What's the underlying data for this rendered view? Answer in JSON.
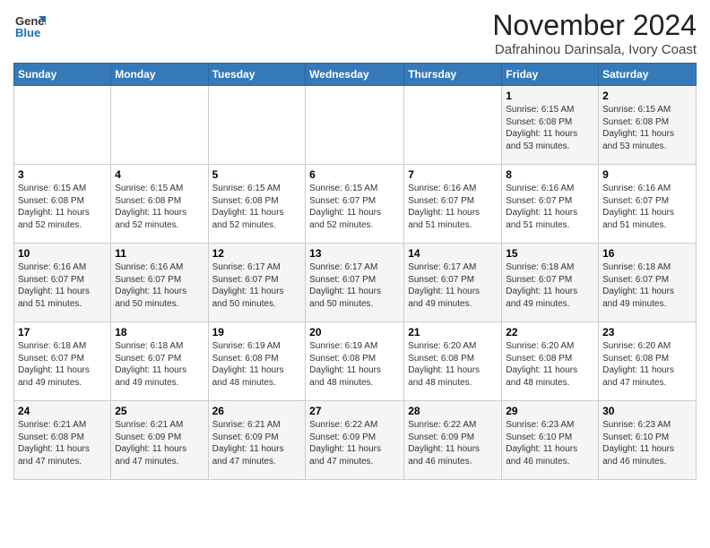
{
  "header": {
    "logo_line1": "General",
    "logo_line2": "Blue",
    "month_year": "November 2024",
    "location": "Dafrahinou Darinsala, Ivory Coast"
  },
  "weekdays": [
    "Sunday",
    "Monday",
    "Tuesday",
    "Wednesday",
    "Thursday",
    "Friday",
    "Saturday"
  ],
  "weeks": [
    [
      {
        "day": "",
        "info": ""
      },
      {
        "day": "",
        "info": ""
      },
      {
        "day": "",
        "info": ""
      },
      {
        "day": "",
        "info": ""
      },
      {
        "day": "",
        "info": ""
      },
      {
        "day": "1",
        "info": "Sunrise: 6:15 AM\nSunset: 6:08 PM\nDaylight: 11 hours\nand 53 minutes."
      },
      {
        "day": "2",
        "info": "Sunrise: 6:15 AM\nSunset: 6:08 PM\nDaylight: 11 hours\nand 53 minutes."
      }
    ],
    [
      {
        "day": "3",
        "info": "Sunrise: 6:15 AM\nSunset: 6:08 PM\nDaylight: 11 hours\nand 52 minutes."
      },
      {
        "day": "4",
        "info": "Sunrise: 6:15 AM\nSunset: 6:08 PM\nDaylight: 11 hours\nand 52 minutes."
      },
      {
        "day": "5",
        "info": "Sunrise: 6:15 AM\nSunset: 6:08 PM\nDaylight: 11 hours\nand 52 minutes."
      },
      {
        "day": "6",
        "info": "Sunrise: 6:15 AM\nSunset: 6:07 PM\nDaylight: 11 hours\nand 52 minutes."
      },
      {
        "day": "7",
        "info": "Sunrise: 6:16 AM\nSunset: 6:07 PM\nDaylight: 11 hours\nand 51 minutes."
      },
      {
        "day": "8",
        "info": "Sunrise: 6:16 AM\nSunset: 6:07 PM\nDaylight: 11 hours\nand 51 minutes."
      },
      {
        "day": "9",
        "info": "Sunrise: 6:16 AM\nSunset: 6:07 PM\nDaylight: 11 hours\nand 51 minutes."
      }
    ],
    [
      {
        "day": "10",
        "info": "Sunrise: 6:16 AM\nSunset: 6:07 PM\nDaylight: 11 hours\nand 51 minutes."
      },
      {
        "day": "11",
        "info": "Sunrise: 6:16 AM\nSunset: 6:07 PM\nDaylight: 11 hours\nand 50 minutes."
      },
      {
        "day": "12",
        "info": "Sunrise: 6:17 AM\nSunset: 6:07 PM\nDaylight: 11 hours\nand 50 minutes."
      },
      {
        "day": "13",
        "info": "Sunrise: 6:17 AM\nSunset: 6:07 PM\nDaylight: 11 hours\nand 50 minutes."
      },
      {
        "day": "14",
        "info": "Sunrise: 6:17 AM\nSunset: 6:07 PM\nDaylight: 11 hours\nand 49 minutes."
      },
      {
        "day": "15",
        "info": "Sunrise: 6:18 AM\nSunset: 6:07 PM\nDaylight: 11 hours\nand 49 minutes."
      },
      {
        "day": "16",
        "info": "Sunrise: 6:18 AM\nSunset: 6:07 PM\nDaylight: 11 hours\nand 49 minutes."
      }
    ],
    [
      {
        "day": "17",
        "info": "Sunrise: 6:18 AM\nSunset: 6:07 PM\nDaylight: 11 hours\nand 49 minutes."
      },
      {
        "day": "18",
        "info": "Sunrise: 6:18 AM\nSunset: 6:07 PM\nDaylight: 11 hours\nand 49 minutes."
      },
      {
        "day": "19",
        "info": "Sunrise: 6:19 AM\nSunset: 6:08 PM\nDaylight: 11 hours\nand 48 minutes."
      },
      {
        "day": "20",
        "info": "Sunrise: 6:19 AM\nSunset: 6:08 PM\nDaylight: 11 hours\nand 48 minutes."
      },
      {
        "day": "21",
        "info": "Sunrise: 6:20 AM\nSunset: 6:08 PM\nDaylight: 11 hours\nand 48 minutes."
      },
      {
        "day": "22",
        "info": "Sunrise: 6:20 AM\nSunset: 6:08 PM\nDaylight: 11 hours\nand 48 minutes."
      },
      {
        "day": "23",
        "info": "Sunrise: 6:20 AM\nSunset: 6:08 PM\nDaylight: 11 hours\nand 47 minutes."
      }
    ],
    [
      {
        "day": "24",
        "info": "Sunrise: 6:21 AM\nSunset: 6:08 PM\nDaylight: 11 hours\nand 47 minutes."
      },
      {
        "day": "25",
        "info": "Sunrise: 6:21 AM\nSunset: 6:09 PM\nDaylight: 11 hours\nand 47 minutes."
      },
      {
        "day": "26",
        "info": "Sunrise: 6:21 AM\nSunset: 6:09 PM\nDaylight: 11 hours\nand 47 minutes."
      },
      {
        "day": "27",
        "info": "Sunrise: 6:22 AM\nSunset: 6:09 PM\nDaylight: 11 hours\nand 47 minutes."
      },
      {
        "day": "28",
        "info": "Sunrise: 6:22 AM\nSunset: 6:09 PM\nDaylight: 11 hours\nand 46 minutes."
      },
      {
        "day": "29",
        "info": "Sunrise: 6:23 AM\nSunset: 6:10 PM\nDaylight: 11 hours\nand 46 minutes."
      },
      {
        "day": "30",
        "info": "Sunrise: 6:23 AM\nSunset: 6:10 PM\nDaylight: 11 hours\nand 46 minutes."
      }
    ]
  ]
}
